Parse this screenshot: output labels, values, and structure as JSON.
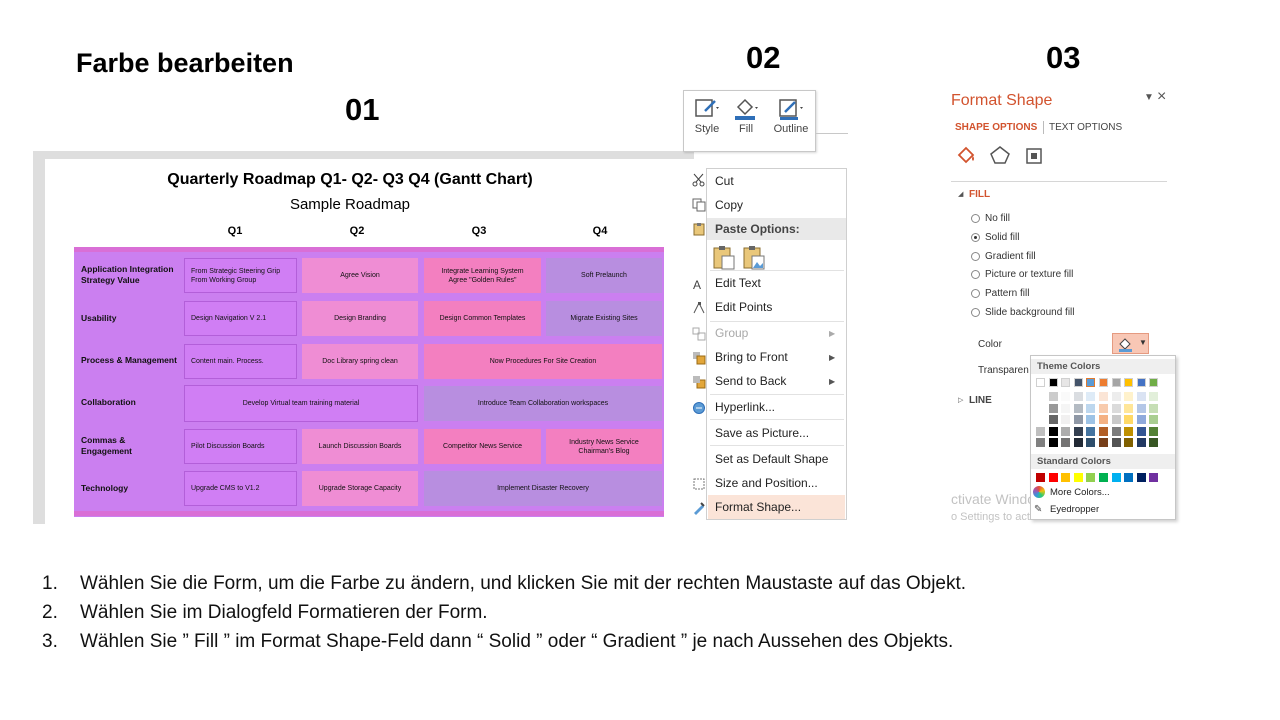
{
  "slide": {
    "title": "Farbe bearbeiten",
    "steps": [
      "01",
      "02",
      "03"
    ],
    "instructions": [
      {
        "num": "1.",
        "text": "Wählen Sie die Form, um die Farbe zu ändern, und klicken Sie mit der rechten Maustaste auf das Objekt."
      },
      {
        "num": "2.",
        "text": "Wählen Sie im Dialogfeld Formatieren der Form."
      },
      {
        "num": "3.",
        "text": "Wählen Sie ” Fill ” im Format Shape-Feld dann “ Solid ” oder “ Gradient ” je nach Aussehen des Objekts."
      }
    ]
  },
  "gantt": {
    "title": "Quarterly Roadmap Q1- Q2- Q3 Q4 (Gantt Chart)",
    "subtitle": "Sample Roadmap",
    "quarters": [
      "Q1",
      "Q2",
      "Q3",
      "Q4"
    ],
    "rows": [
      {
        "label": "Application Integration Strategy Value",
        "bars": [
          "From Strategic Steering Grip\nFrom Working Group",
          "Agree Vision",
          "Integrate Learning System\nAgree \"Golden Rules\"",
          "Soft Prelaunch"
        ]
      },
      {
        "label": "Usability",
        "bars": [
          "Design Navigation V 2.1",
          "Design Branding",
          "Design Common Templates",
          "Migrate Existing Sites"
        ]
      },
      {
        "label": "Process & Management",
        "bars": [
          "Content main. Process.",
          "Doc Library spring clean",
          "Now Procedures For Site Creation"
        ]
      },
      {
        "label": "Collaboration",
        "bars": [
          "Develop Virtual team training material",
          "Introduce Team Collaboration workspaces"
        ]
      },
      {
        "label": "Commas & Engagement",
        "bars": [
          "Pilot Discussion Boards",
          "Launch Discussion Boards",
          "Competitor News Service",
          "Industry News Service\nChairman's Blog"
        ]
      },
      {
        "label": "Technology",
        "bars": [
          "Upgrade CMS to V1.2",
          "Upgrade Storage Capacity",
          "Implement Disaster Recovery"
        ]
      }
    ],
    "colors": {
      "violet": "#d07ef4",
      "pink": "#ef8dd4",
      "hotpink": "#f37fc0",
      "lavender": "#b88ee0"
    }
  },
  "toolbar": {
    "style": "Style",
    "fill": "Fill",
    "outline": "Outline"
  },
  "context_menu": {
    "cut": "Cut",
    "copy": "Copy",
    "paste_options": "Paste Options:",
    "edit_text": "Edit Text",
    "edit_points": "Edit Points",
    "group": "Group",
    "bring_to_front": "Bring to Front",
    "send_to_back": "Send to Back",
    "hyperlink": "Hyperlink...",
    "save_as_picture": "Save as Picture...",
    "set_default": "Set as Default Shape",
    "size_position": "Size and Position...",
    "format_shape": "Format Shape..."
  },
  "format_pane": {
    "title": "Format Shape",
    "tab_shape": "SHAPE OPTIONS",
    "tab_text": "TEXT OPTIONS",
    "fill_section": "FILL",
    "fill_options": [
      "No fill",
      "Solid fill",
      "Gradient fill",
      "Picture or texture fill",
      "Pattern fill",
      "Slide background fill"
    ],
    "fill_selected": 1,
    "color_label": "Color",
    "transparency_label": "Transparen",
    "line_section": "LINE",
    "palette": {
      "theme_header": "Theme Colors",
      "standard_header": "Standard Colors",
      "more_colors": "More Colors...",
      "eyedropper": "Eyedropper",
      "theme_top": [
        "#ffffff",
        "#000000",
        "#e7e6e6",
        "#44546a",
        "#5b9bd5",
        "#ed7d31",
        "#a5a5a5",
        "#ffc000",
        "#4472c4",
        "#70ad47"
      ],
      "standard": [
        "#c00000",
        "#ff0000",
        "#ffc000",
        "#ffff00",
        "#92d050",
        "#00b050",
        "#00b0f0",
        "#0070c0",
        "#002060",
        "#7030a0"
      ]
    },
    "watermark_line1": "ctivate Windows",
    "watermark_line2": "o Settings to activate Windows."
  }
}
